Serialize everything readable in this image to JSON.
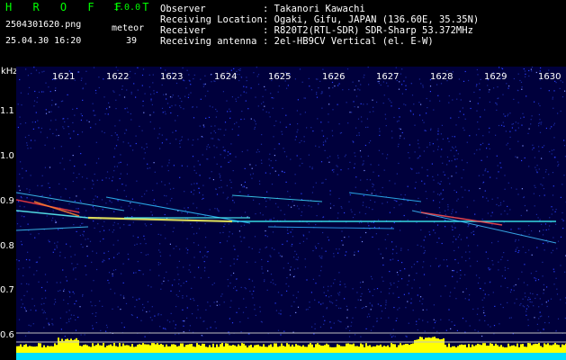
{
  "header": {
    "app_title": "H R O F F T",
    "app_version": "1.0.0",
    "file_name": "2504301620.png",
    "datetime": "25.04.30 16:20",
    "meteor_label": "meteor",
    "meteor_count": "39",
    "fields": [
      {
        "key": "Observer",
        "value": ": Takanori Kawachi"
      },
      {
        "key": "Receiving Location",
        "value": ": Ogaki, Gifu, JAPAN (136.60E, 35.35N)"
      },
      {
        "key": "Receiver",
        "value": ": R820T2(RTL-SDR) SDR-Sharp 53.372MHz"
      },
      {
        "key": "Receiving antenna",
        "value": ": 2el-HB9CV Vertical (el. E-W)"
      }
    ]
  },
  "plot": {
    "y_unit": "kHz",
    "y_ticks": [
      "1.1",
      "1.0",
      "0.9",
      "0.8",
      "0.7",
      "0.6"
    ],
    "x_ticks": [
      "1621",
      "1622",
      "1623",
      "1624",
      "1625",
      "1626",
      "1627",
      "1628",
      "1629",
      "1630"
    ],
    "colors": {
      "background": "#00003c",
      "noise": "#2a40ff",
      "signal": "#00ffff",
      "hot": "#ff3030",
      "spectrum": "#ffff00",
      "spectrum_base": "#00e0ff"
    }
  }
}
